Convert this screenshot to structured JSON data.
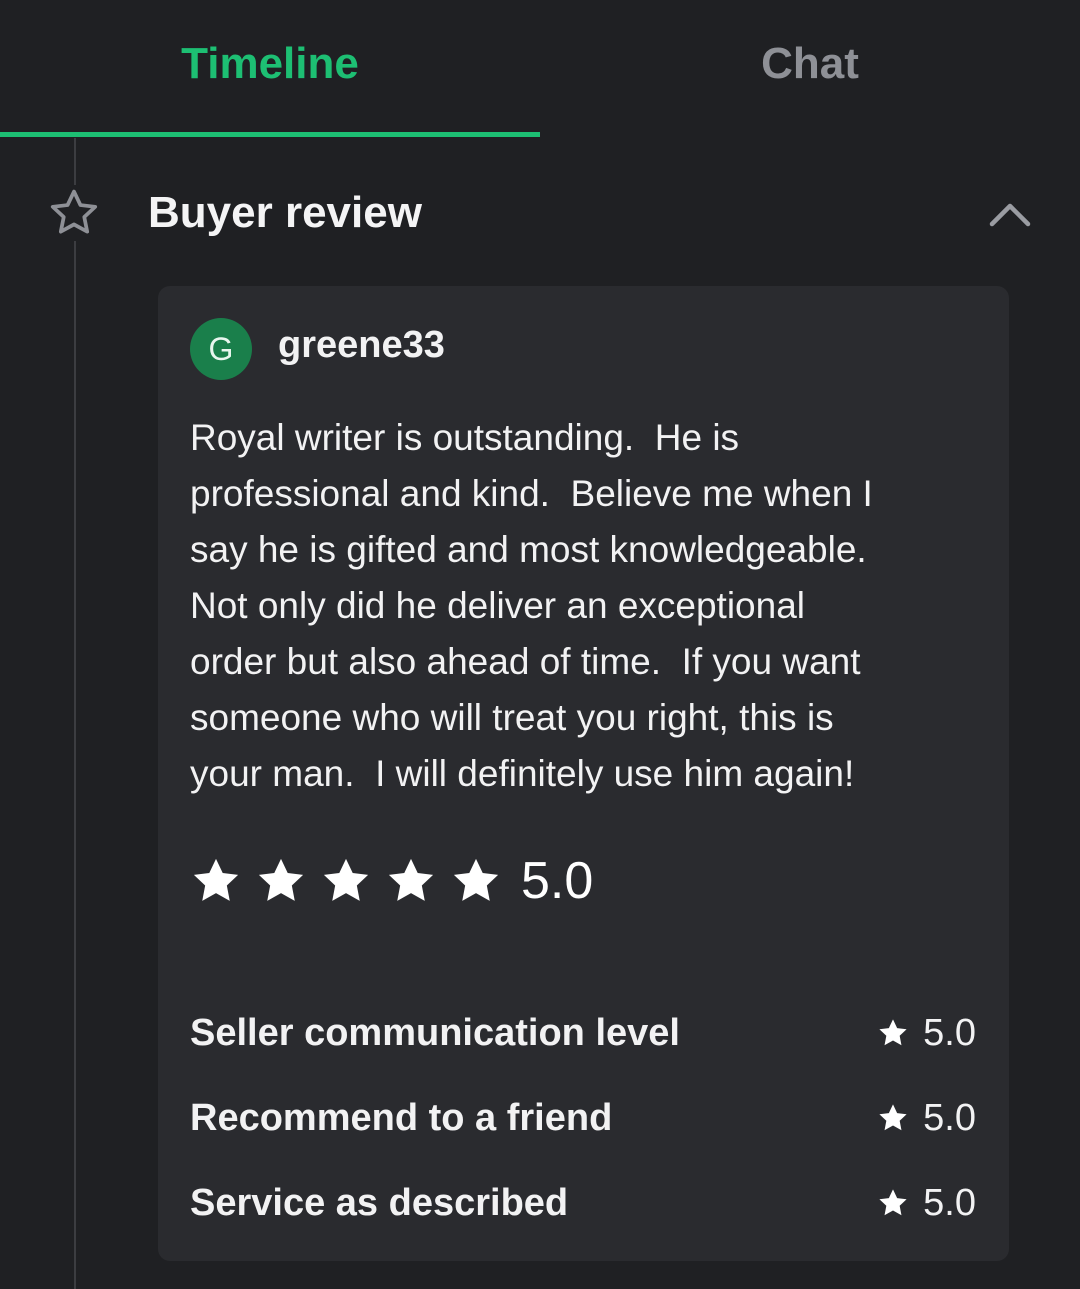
{
  "tabs": {
    "timeline": "Timeline",
    "chat": "Chat"
  },
  "section": {
    "title": "Buyer review",
    "icon": "star-outline-icon",
    "collapse_icon": "chevron-up-icon"
  },
  "review": {
    "avatar_letter": "G",
    "username": "greene33",
    "text": "Royal writer is outstanding.  He is\nprofessional and kind.  Believe me when I\nsay he is gifted and most knowledgeable.\nNot only did he deliver an exceptional\norder but also ahead of time.  If you want\nsomeone who will treat you right, this is\nyour man.  I will definitely use him again!",
    "overall_rating": "5.0",
    "stars": 5,
    "breakdown": [
      {
        "label": "Seller communication level",
        "score": "5.0"
      },
      {
        "label": "Recommend to a friend",
        "score": "5.0"
      },
      {
        "label": "Service as described",
        "score": "5.0"
      }
    ]
  },
  "colors": {
    "accent": "#1dbf73",
    "background": "#1f2023",
    "card": "#2a2b2f",
    "avatar": "#1a7f4b",
    "inactive_tab": "#8e9096"
  }
}
